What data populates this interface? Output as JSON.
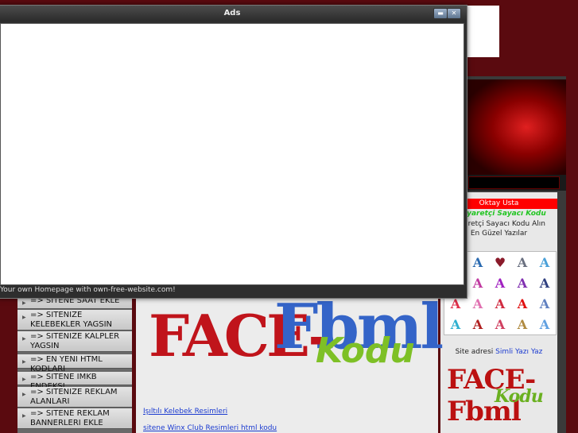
{
  "ads_window": {
    "title": "Ads",
    "status_text": "Your own Homepage with own-free-website.com!"
  },
  "right_panel": {
    "name_bar": "Oktay Usta",
    "counter_title": "e Ziyaretçi Sayacı Kodu",
    "counter_text_line1": "Ziyaretçi Sayacı Kodu Alın",
    "counter_text_line2": "En Güzel Yazılar",
    "site_address_prefix": "Site adresi",
    "site_address_link": "Simli Yazı Yaz",
    "logo_text": "FACE-Fbml",
    "logo_sub": "Kodu"
  },
  "menu": {
    "items": [
      {
        "label": "=> SITENE SAAT EKLE"
      },
      {
        "label": "=> SITENIZE KELEBEKLER YAGSIN"
      },
      {
        "label": "=> SITENIZE KALPLER YAGSIN"
      },
      {
        "label": "=> EN YENI HTML KODLARI"
      },
      {
        "label": "=> SITENE IMKB ENDEKSI"
      },
      {
        "label": "=> SITENIZE REKLAM ALANLARI"
      },
      {
        "label": "=> SITENE REKLAM BANNERLERI EKLE"
      }
    ]
  },
  "content": {
    "logo_face": "FACE-",
    "logo_fbml": "Fbml",
    "logo_kodu": "Kodu",
    "link1": "Işıltılı Kelebek Resimleri",
    "link2": "sitene Winx Club Resimleri html kodu"
  },
  "colors": {
    "background": "#5a0a0f",
    "accent_red": "#ff0000",
    "link_blue": "#1a3ad0",
    "green_title": "#22c522"
  }
}
